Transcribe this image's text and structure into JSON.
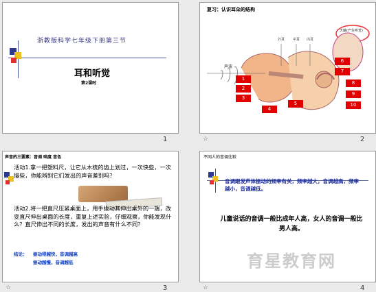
{
  "slide1": {
    "subtitle": "浙教版科学七年级下册第三节",
    "title": "耳和听觉",
    "lesson": "第2课时",
    "number": "1"
  },
  "slide2": {
    "heading": "复习：认识耳朵的结构",
    "bubble": "大脑(产生听觉)",
    "labels": [
      "外耳",
      "中耳",
      "内耳"
    ],
    "sound_label": "声波",
    "boxes": [
      "1",
      "2",
      "3",
      "4",
      "5",
      "6",
      "7",
      "8",
      "9",
      "10"
    ],
    "number": "2"
  },
  "slide3": {
    "heading": "声音的三要素：音调 响度 音色",
    "activity1": "活动1.拿一把塑料尺，让它从木梳的齿上划过，一次快些，一次慢些，你能辨别它们发出的声音差别吗？",
    "activity2": "活动2.将一把直尺压紧桌面上，用手拨动其伸出桌外的一端，改变直尺伸出桌面的长度，重复上述实验，仔细观察，你能发现什么？直尺伸出不同的长度，发出的声音有什么不同？",
    "conclusion_label": "结论：",
    "conclusion1": "振动得越快，音调越高",
    "conclusion2": "振动越慢，音调越低",
    "number": "3"
  },
  "slide4": {
    "heading": "不同人的音调比较",
    "line1": "音调跟发声体振动的频率有关，频率越大，音调越高，频率越小，音调越低。",
    "line2": "儿童说话的音调一般比成年人高，女人的音调一般比男人高。",
    "watermark": "育星教育网",
    "number": "4"
  },
  "star": "☆"
}
